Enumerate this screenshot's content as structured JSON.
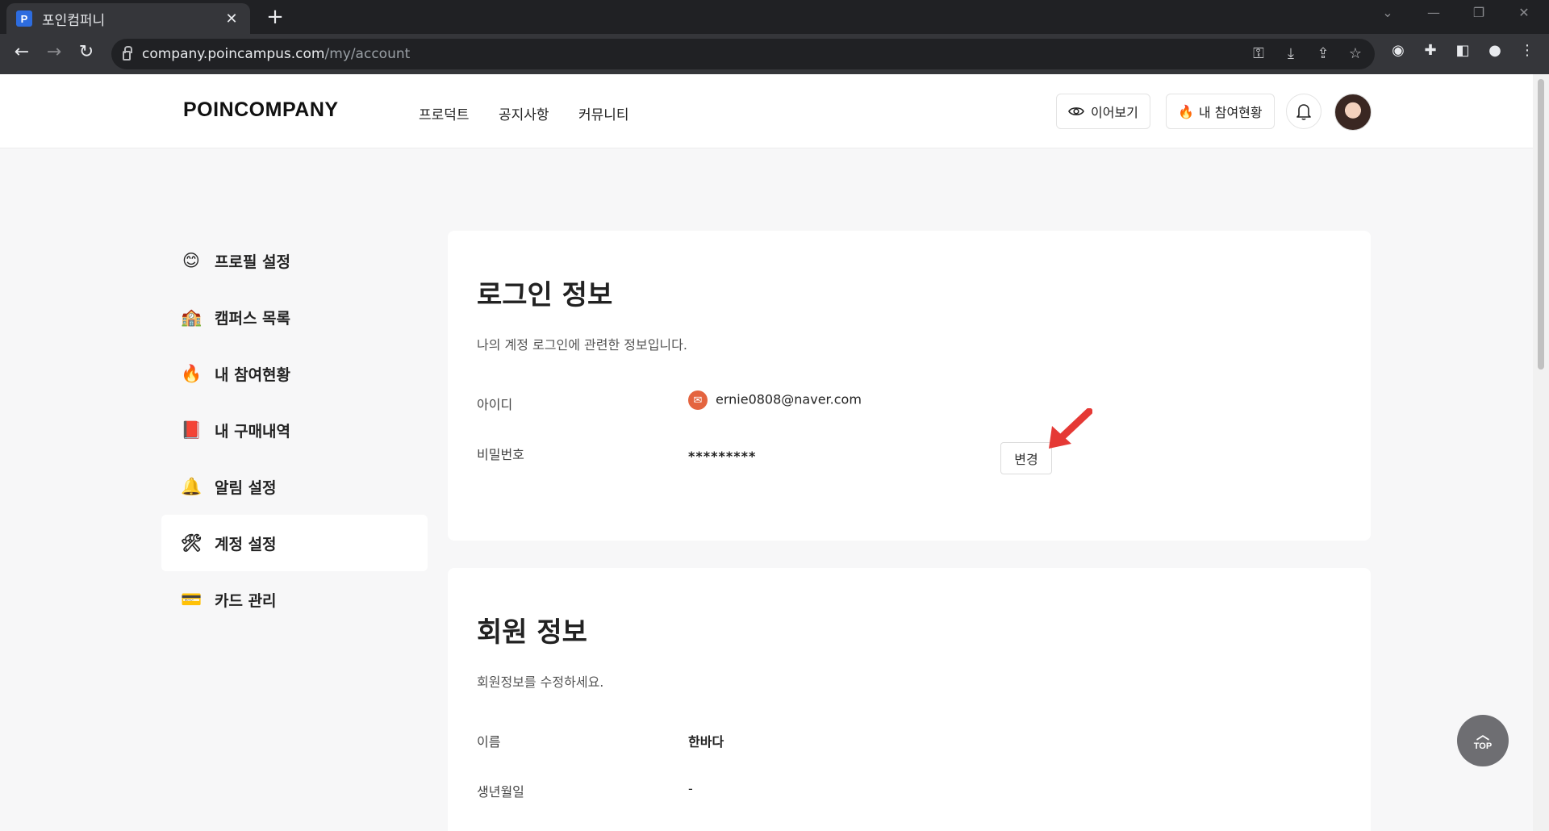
{
  "browser": {
    "tab_title": "포인컴퍼니",
    "tab_favicon": "P",
    "url_host": "company.poincampus.com",
    "url_path": "/my/account"
  },
  "header": {
    "logo": "POINCOMPANY",
    "nav": [
      "프로덕트",
      "공지사항",
      "커뮤니티"
    ],
    "continue_label": "이어보기",
    "participation_label": "내 참여현황"
  },
  "sidebar": {
    "items": [
      {
        "icon": "smile-emoji-icon",
        "glyph": "😊",
        "label": "프로필 설정",
        "active": false
      },
      {
        "icon": "school-building-icon",
        "glyph": "🏫",
        "label": "캠퍼스 목록",
        "active": false
      },
      {
        "icon": "fire-icon",
        "glyph": "🔥",
        "label": "내 참여현황",
        "active": false
      },
      {
        "icon": "red-book-icon",
        "glyph": "📕",
        "label": "내 구매내역",
        "active": false
      },
      {
        "icon": "bell-emoji-icon",
        "glyph": "🔔",
        "label": "알림 설정",
        "active": false
      },
      {
        "icon": "tools-icon",
        "glyph": "🛠",
        "label": "계정 설정",
        "active": true
      },
      {
        "icon": "credit-card-icon",
        "glyph": "💳",
        "label": "카드 관리",
        "active": false
      }
    ]
  },
  "login_info": {
    "title": "로그인 정보",
    "description": "나의 계정 로그인에 관련한 정보입니다.",
    "id_label": "아이디",
    "id_value": "ernie0808@naver.com",
    "password_label": "비밀번호",
    "password_value": "*********",
    "change_button": "변경"
  },
  "member_info": {
    "title": "회원 정보",
    "description": "회원정보를 수정하세요.",
    "name_label": "이름",
    "name_value": "한바다",
    "birth_label": "생년월일",
    "birth_value": "-"
  },
  "top_button": "TOP",
  "colors": {
    "accent_arrow": "#e53935",
    "mail_badge": "#e4643f"
  }
}
